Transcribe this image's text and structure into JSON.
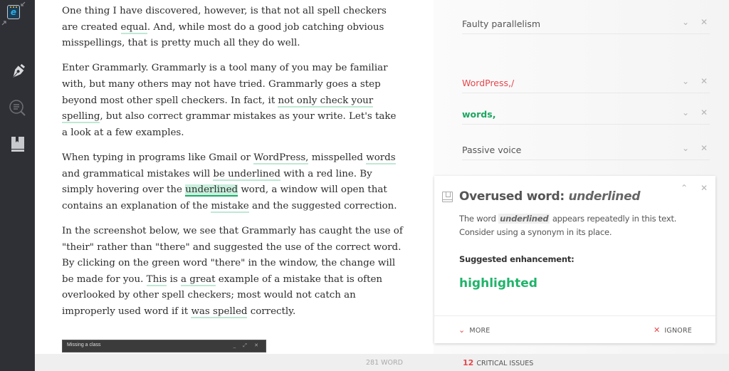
{
  "sidebar": {
    "items": [
      {
        "icon": "app-logo-icon",
        "label": "Grammarly"
      },
      {
        "icon": "pen-icon",
        "label": "Write"
      },
      {
        "icon": "search-document-icon",
        "label": "Plagiarism"
      },
      {
        "icon": "book-icon",
        "label": "Dictionary"
      }
    ]
  },
  "document": {
    "paragraphs": [
      {
        "segments": [
          {
            "text": "One thing I have discovered, however, is that not all spell checkers are created "
          },
          {
            "text": "equal",
            "mark": "underline"
          },
          {
            "text": ". And, while most do a good job catching obvious misspellings, that is pretty much all they do well."
          }
        ]
      },
      {
        "segments": [
          {
            "text": "Enter Grammarly. Grammarly is a tool many of you may be familiar with, but many others may not have tried. Grammarly goes a step beyond most other spell checkers. In fact, it "
          },
          {
            "text": "not only check your spelling",
            "mark": "underline"
          },
          {
            "text": ", but also correct grammar mistakes as your write. Let's take a look at a few examples."
          }
        ]
      },
      {
        "segments": [
          {
            "text": "When typing in programs like Gmail or "
          },
          {
            "text": "WordPress,",
            "mark": "underline"
          },
          {
            "text": " misspelled "
          },
          {
            "text": "words",
            "mark": "underline"
          },
          {
            "text": " and grammatical mistakes will "
          },
          {
            "text": "be underlined",
            "mark": "underline"
          },
          {
            "text": " with a red line. By simply hovering over the "
          },
          {
            "text": "underlined",
            "mark": "highlight"
          },
          {
            "text": " word, a window will open that contains an explanation of the "
          },
          {
            "text": "mistake",
            "mark": "underline"
          },
          {
            "text": " and the suggested correction."
          }
        ]
      },
      {
        "segments": [
          {
            "text": "In the screenshot below, we see that Grammarly has caught the use of \"their\" rather than \"there\" and suggested the use of the correct word. By clicking on the green word \"there\" in the window, the change will be made for you. "
          },
          {
            "text": "This",
            "mark": "underline"
          },
          {
            "text": " is "
          },
          {
            "text": "a great",
            "mark": "underline"
          },
          {
            "text": " example of a mistake that is often overlooked by other spell checkers; most would not catch an improperly used word if it "
          },
          {
            "text": "was spelled",
            "mark": "underline"
          },
          {
            "text": " correctly."
          }
        ]
      }
    ],
    "embedded_image": {
      "title": "Missing a class",
      "controls": [
        "_",
        "⤢",
        "✕"
      ]
    }
  },
  "panel": {
    "issues": [
      {
        "title": "Faulty parallelism",
        "style": "normal"
      },
      {
        "title": "WordPress,/",
        "style": "red"
      },
      {
        "title": "words,",
        "style": "green"
      },
      {
        "title": "Passive voice",
        "style": "normal"
      }
    ],
    "issue_controls": {
      "expand": "⌄",
      "dismiss": "✕"
    },
    "card": {
      "title_prefix": "Overused word: ",
      "title_word": "underlined",
      "desc_prefix": "The word ",
      "desc_word": "underlined",
      "desc_suffix": " appears repeatedly in this text. Consider using a synonym in its place.",
      "suggestion_label": "Suggested enhancement:",
      "suggestion": "highlighted",
      "collapse": "⌃",
      "close": "✕",
      "more_label": "MORE",
      "ignore_label": "IGNORE"
    }
  },
  "status": {
    "word_count": "281 WORD",
    "critical_count": "12",
    "critical_label": "CRITICAL ISSUES"
  },
  "colors": {
    "accent_green": "#1fb36a",
    "error_red": "#e5484d",
    "underline_green": "#bfe8d5",
    "sidebar_bg": "#2f3035"
  }
}
